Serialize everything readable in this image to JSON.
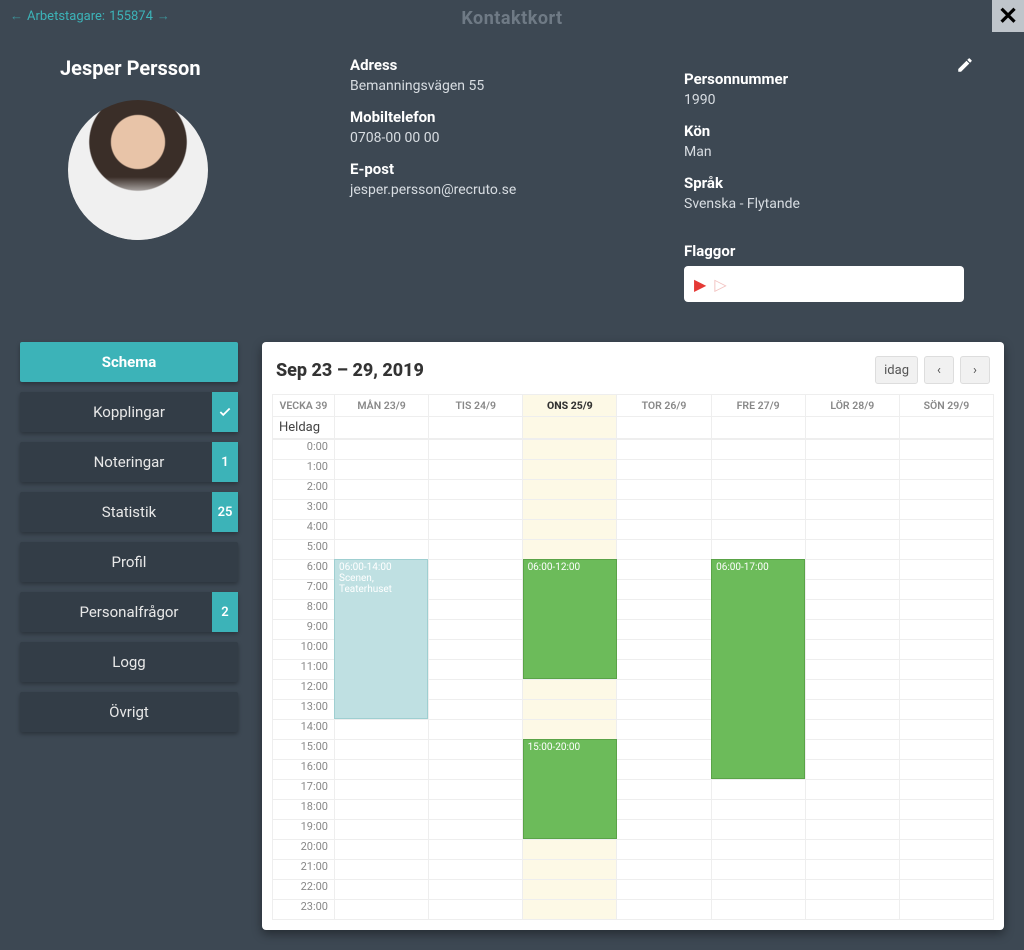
{
  "header": {
    "breadcrumb_prefix": "Arbetstagare:",
    "breadcrumb_id": "155874",
    "title": "Kontaktkort"
  },
  "person": {
    "name": "Jesper Persson",
    "address_label": "Adress",
    "address_value": "Bemanningsvägen 55",
    "mobile_label": "Mobiltelefon",
    "mobile_value": "0708-00 00 00",
    "email_label": "E-post",
    "email_value": "jesper.persson@recruto.se",
    "ssn_label": "Personnummer",
    "ssn_value": "1990",
    "gender_label": "Kön",
    "gender_value": "Man",
    "language_label": "Språk",
    "language_value": "Svenska - Flytande",
    "flags_label": "Flaggor"
  },
  "sidebar": {
    "items": [
      {
        "label": "Schema",
        "active": true,
        "badge": null
      },
      {
        "label": "Kopplingar",
        "badge": "✓"
      },
      {
        "label": "Noteringar",
        "badge": "1"
      },
      {
        "label": "Statistik",
        "badge": "25"
      },
      {
        "label": "Profil",
        "badge": null
      },
      {
        "label": "Personalfrågor",
        "badge": "2"
      },
      {
        "label": "Logg",
        "badge": null
      },
      {
        "label": "Övrigt",
        "badge": null
      }
    ]
  },
  "schedule": {
    "range_label": "Sep 23 – 29, 2019",
    "today_label": "idag",
    "week_label": "VECKA 39",
    "allday_label": "Heldag",
    "days": [
      {
        "label": "MÅN 23/9",
        "today": false
      },
      {
        "label": "TIS 24/9",
        "today": false
      },
      {
        "label": "ONS 25/9",
        "today": true
      },
      {
        "label": "TOR 26/9",
        "today": false
      },
      {
        "label": "FRE 27/9",
        "today": false
      },
      {
        "label": "LÖR 28/9",
        "today": false
      },
      {
        "label": "SÖN 29/9",
        "today": false
      }
    ],
    "hours": [
      "0:00",
      "1:00",
      "2:00",
      "3:00",
      "4:00",
      "5:00",
      "6:00",
      "7:00",
      "8:00",
      "9:00",
      "10:00",
      "11:00",
      "12:00",
      "13:00",
      "14:00",
      "15:00",
      "16:00",
      "17:00",
      "18:00",
      "19:00",
      "20:00",
      "21:00",
      "22:00",
      "23:00"
    ],
    "events": [
      {
        "day": 0,
        "start": 6,
        "end": 14,
        "title": "06:00-14:00",
        "subtitle": "Scenen, Teaterhuset",
        "tentative": true
      },
      {
        "day": 2,
        "start": 6,
        "end": 12,
        "title": "06:00-12:00",
        "subtitle": "",
        "tentative": false
      },
      {
        "day": 2,
        "start": 15,
        "end": 20,
        "title": "15:00-20:00",
        "subtitle": "",
        "tentative": false
      },
      {
        "day": 4,
        "start": 6,
        "end": 17,
        "title": "06:00-17:00",
        "subtitle": "",
        "tentative": false
      }
    ]
  }
}
